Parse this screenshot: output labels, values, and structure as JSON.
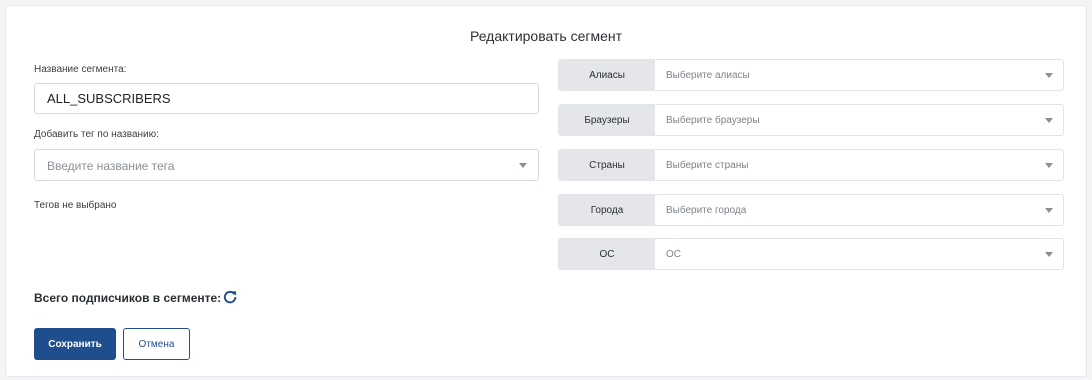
{
  "form": {
    "title": "Редактировать сегмент",
    "segment_name_label": "Название сегмента:",
    "segment_name_value": "ALL_SUBSCRIBERS",
    "tag_label": "Добавить тег по названию:",
    "tag_placeholder": "Введите название тега",
    "no_tags_text": "Тегов не выбрано",
    "total_label": "Всего подписчиков в сегменте:",
    "save_label": "Сохранить",
    "cancel_label": "Отмена"
  },
  "filters": [
    {
      "label": "Алиасы",
      "placeholder": "Выберите алиасы"
    },
    {
      "label": "Браузеры",
      "placeholder": "Выберите браузеры"
    },
    {
      "label": "Страны",
      "placeholder": "Выберите страны"
    },
    {
      "label": "Города",
      "placeholder": "Выберите города"
    },
    {
      "label": "ОС",
      "placeholder": "ОС"
    }
  ],
  "icons": {
    "refresh": "refresh-icon",
    "dropdown": "chevron-down-icon"
  },
  "colors": {
    "primary": "#1f4e8c",
    "label_bg": "#e4e6ea"
  }
}
